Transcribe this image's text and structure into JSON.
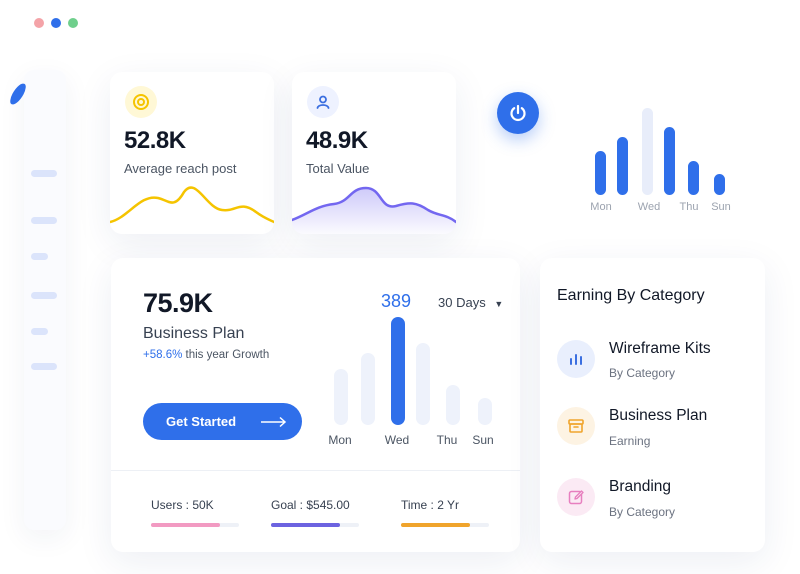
{
  "window": {
    "dot_colors": [
      "#f4a3a8",
      "#2f6fea",
      "#6fcf8c"
    ]
  },
  "stats": [
    {
      "value": "52.8K",
      "label": "Average reach post",
      "icon": "target-icon",
      "accent": "#f5c400"
    },
    {
      "value": "48.9K",
      "label": "Total Value",
      "icon": "user-icon",
      "accent": "#7367f0"
    }
  ],
  "weekly_chart": {
    "days": [
      "Mon",
      "Wed",
      "Thu",
      "Sun"
    ],
    "bar_levels": [
      0.48,
      0.63,
      0.95,
      0.74,
      0.37,
      0.23
    ],
    "bar_color": "#2f6fea",
    "muted_bar_color": "#e8edfa"
  },
  "business_plan": {
    "value": "75.9K",
    "title": "Business Plan",
    "growth_pct": "+58.6%",
    "growth_text": "this year Growth",
    "button_label": "Get Started",
    "peak_value": "389",
    "range_select": "30 Days",
    "days": [
      "Mon",
      "Wed",
      "Thu",
      "Sun"
    ],
    "bar_levels": [
      0.52,
      0.67,
      1.0,
      0.76,
      0.37,
      0.25
    ],
    "highlight_index": 2
  },
  "footer_stats": [
    {
      "label": "Users : 50K",
      "progress": 0.78,
      "color": "#f29ac2"
    },
    {
      "label": "Goal : $545.00",
      "progress": 0.78,
      "color": "#6c63e0"
    },
    {
      "label": "Time : 2 Yr",
      "progress": 0.78,
      "color": "#f0a42c"
    }
  ],
  "category_card": {
    "title": "Earning By Category",
    "items": [
      {
        "name": "Wireframe Kits",
        "sub": "By Category",
        "icon": "bar-chart-icon",
        "color": "#3b6fe0",
        "bg": "#e9effd"
      },
      {
        "name": "Business Plan",
        "sub": "Earning",
        "icon": "archive-box-icon",
        "color": "#f0a42c",
        "bg": "#fdf3e3"
      },
      {
        "name": "Branding",
        "sub": "By Category",
        "icon": "edit-pencil-icon",
        "color": "#e77fbf",
        "bg": "#fbeaf4"
      }
    ]
  }
}
